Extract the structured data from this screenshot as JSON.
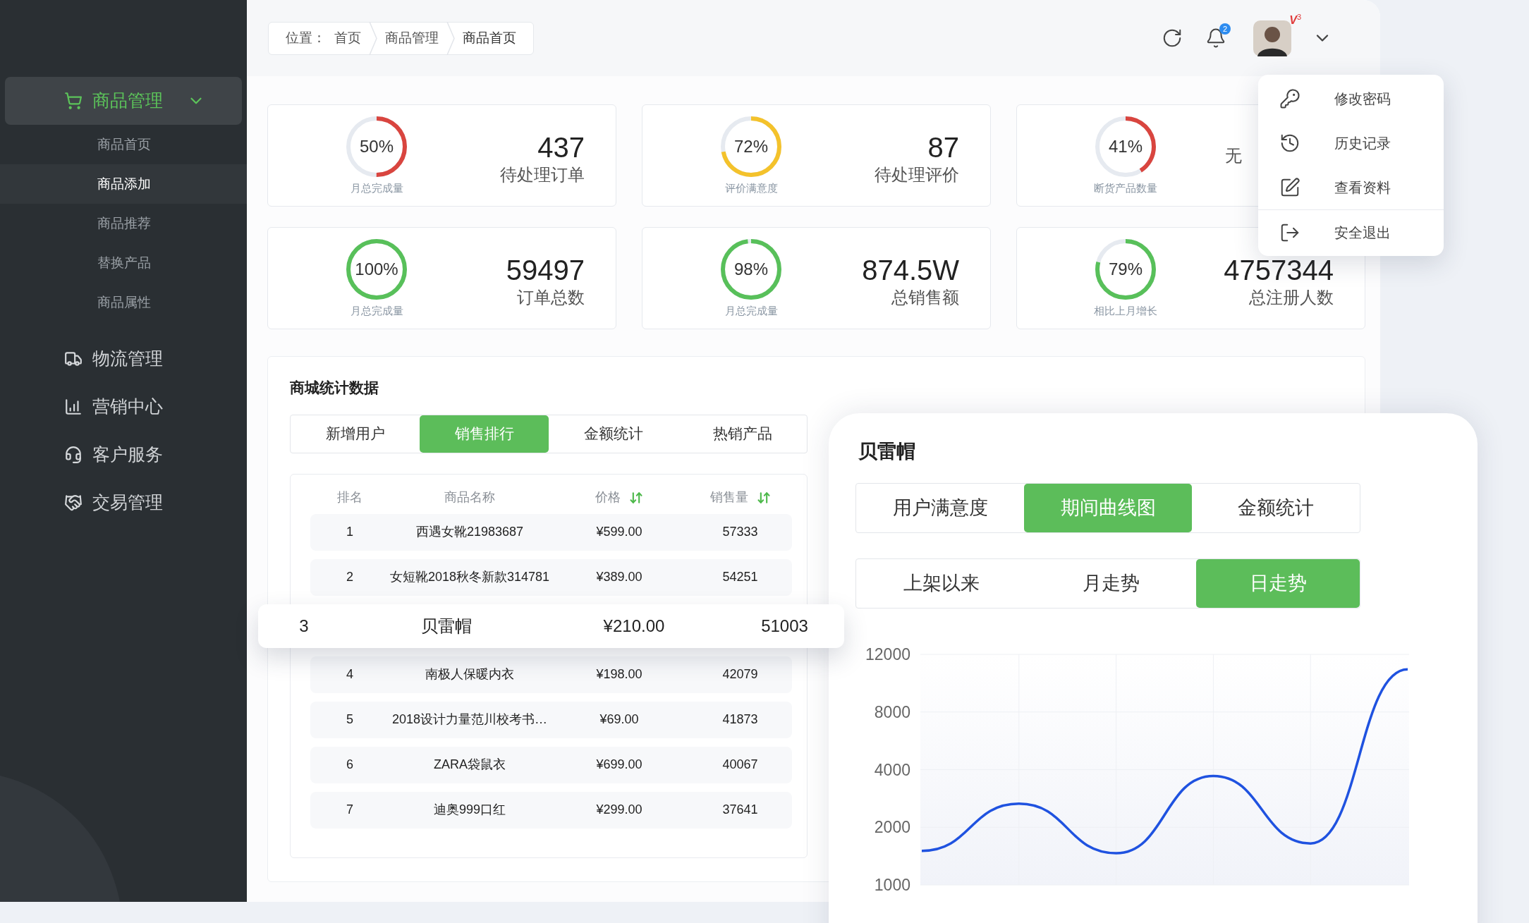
{
  "sidebar": {
    "items": [
      {
        "label": "商品管理",
        "selected": true,
        "expanded": true,
        "children": [
          {
            "label": "商品首页",
            "selected": false
          },
          {
            "label": "商品添加",
            "selected": true
          },
          {
            "label": "商品推荐",
            "selected": false
          },
          {
            "label": "替换产品",
            "selected": false
          },
          {
            "label": "商品属性",
            "selected": false
          }
        ]
      },
      {
        "label": "物流管理",
        "selected": false,
        "expanded": false
      },
      {
        "label": "营销中心",
        "selected": false,
        "expanded": false
      },
      {
        "label": "客户服务",
        "selected": false,
        "expanded": false
      },
      {
        "label": "交易管理",
        "selected": false,
        "expanded": false
      }
    ]
  },
  "breadcrumb": {
    "prefix": "位置：",
    "items": [
      "首页",
      "商品管理",
      "商品首页"
    ]
  },
  "topbar": {
    "notification_count": "2",
    "user_level": {
      "letter": "V",
      "number": "3"
    }
  },
  "user_menu": {
    "items": [
      {
        "label": "修改密码"
      },
      {
        "label": "历史记录"
      },
      {
        "label": "查看资料"
      },
      {
        "label": "安全退出"
      }
    ]
  },
  "stats": [
    {
      "percent": "50%",
      "level": 0.5,
      "color": "#d9453f",
      "caption": "月总完成量",
      "value": "437",
      "label": "待处理订单"
    },
    {
      "percent": "72%",
      "level": 0.72,
      "color": "#f4c22b",
      "caption": "评价满意度",
      "value": "87",
      "label": "待处理评价"
    },
    {
      "percent": "41%",
      "level": 0.41,
      "color": "#d9453f",
      "caption": "断货产品数量",
      "label": "无"
    },
    {
      "percent": "100%",
      "level": 1,
      "color": "#58c05a",
      "caption": "月总完成量",
      "value": "59497",
      "label": "订单总数"
    },
    {
      "percent": "98%",
      "level": 0.98,
      "color": "#58c05a",
      "caption": "月总完成量",
      "value": "874.5W",
      "label": "总销售额"
    },
    {
      "percent": "79%",
      "level": 0.79,
      "color": "#58c05a",
      "caption": "相比上月增长",
      "value": "4757344",
      "label": "总注册人数"
    }
  ],
  "shop_stats": {
    "title": "商城统计数据",
    "tabs": [
      {
        "label": "新增用户",
        "selected": false
      },
      {
        "label": "销售排行",
        "selected": true
      },
      {
        "label": "金额统计",
        "selected": false
      },
      {
        "label": "热销产品",
        "selected": false
      }
    ],
    "table": {
      "columns": [
        {
          "label": "排名",
          "sortable": false
        },
        {
          "label": "商品名称",
          "sortable": false
        },
        {
          "label": "价格",
          "sortable": true
        },
        {
          "label": "销售量",
          "sortable": true
        }
      ],
      "rows": [
        {
          "selected": false,
          "cells": [
            "1",
            "西遇女靴21983687",
            "¥599.00",
            "57333"
          ]
        },
        {
          "selected": false,
          "cells": [
            "2",
            "女短靴2018秋冬新款314781",
            "¥389.00",
            "54251"
          ]
        },
        {
          "selected": true,
          "cells": [
            "3",
            "贝雷帽",
            "¥210.00",
            "51003"
          ]
        },
        {
          "selected": false,
          "cells": [
            "4",
            "南极人保暖内衣",
            "¥198.00",
            "42079"
          ]
        },
        {
          "selected": false,
          "cells": [
            "5",
            "2018设计力量范川校考书…",
            "¥69.00",
            "41873"
          ]
        },
        {
          "selected": false,
          "cells": [
            "6",
            "ZARA袋鼠衣",
            "¥699.00",
            "40067"
          ]
        },
        {
          "selected": false,
          "cells": [
            "7",
            "迪奥999口红",
            "¥299.00",
            "37641"
          ]
        }
      ]
    }
  },
  "product_panel": {
    "title": "贝雷帽",
    "tabs": [
      {
        "label": "用户满意度",
        "selected": false
      },
      {
        "label": "期间曲线图",
        "selected": true
      },
      {
        "label": "金额统计",
        "selected": false
      }
    ],
    "range_tabs": [
      {
        "label": "上架以来",
        "selected": false
      },
      {
        "label": "月走势",
        "selected": false
      },
      {
        "label": "日走势",
        "selected": true
      }
    ],
    "y_axis_labels": [
      "12000",
      "8000",
      "4000",
      "2000",
      "1000"
    ]
  }
}
